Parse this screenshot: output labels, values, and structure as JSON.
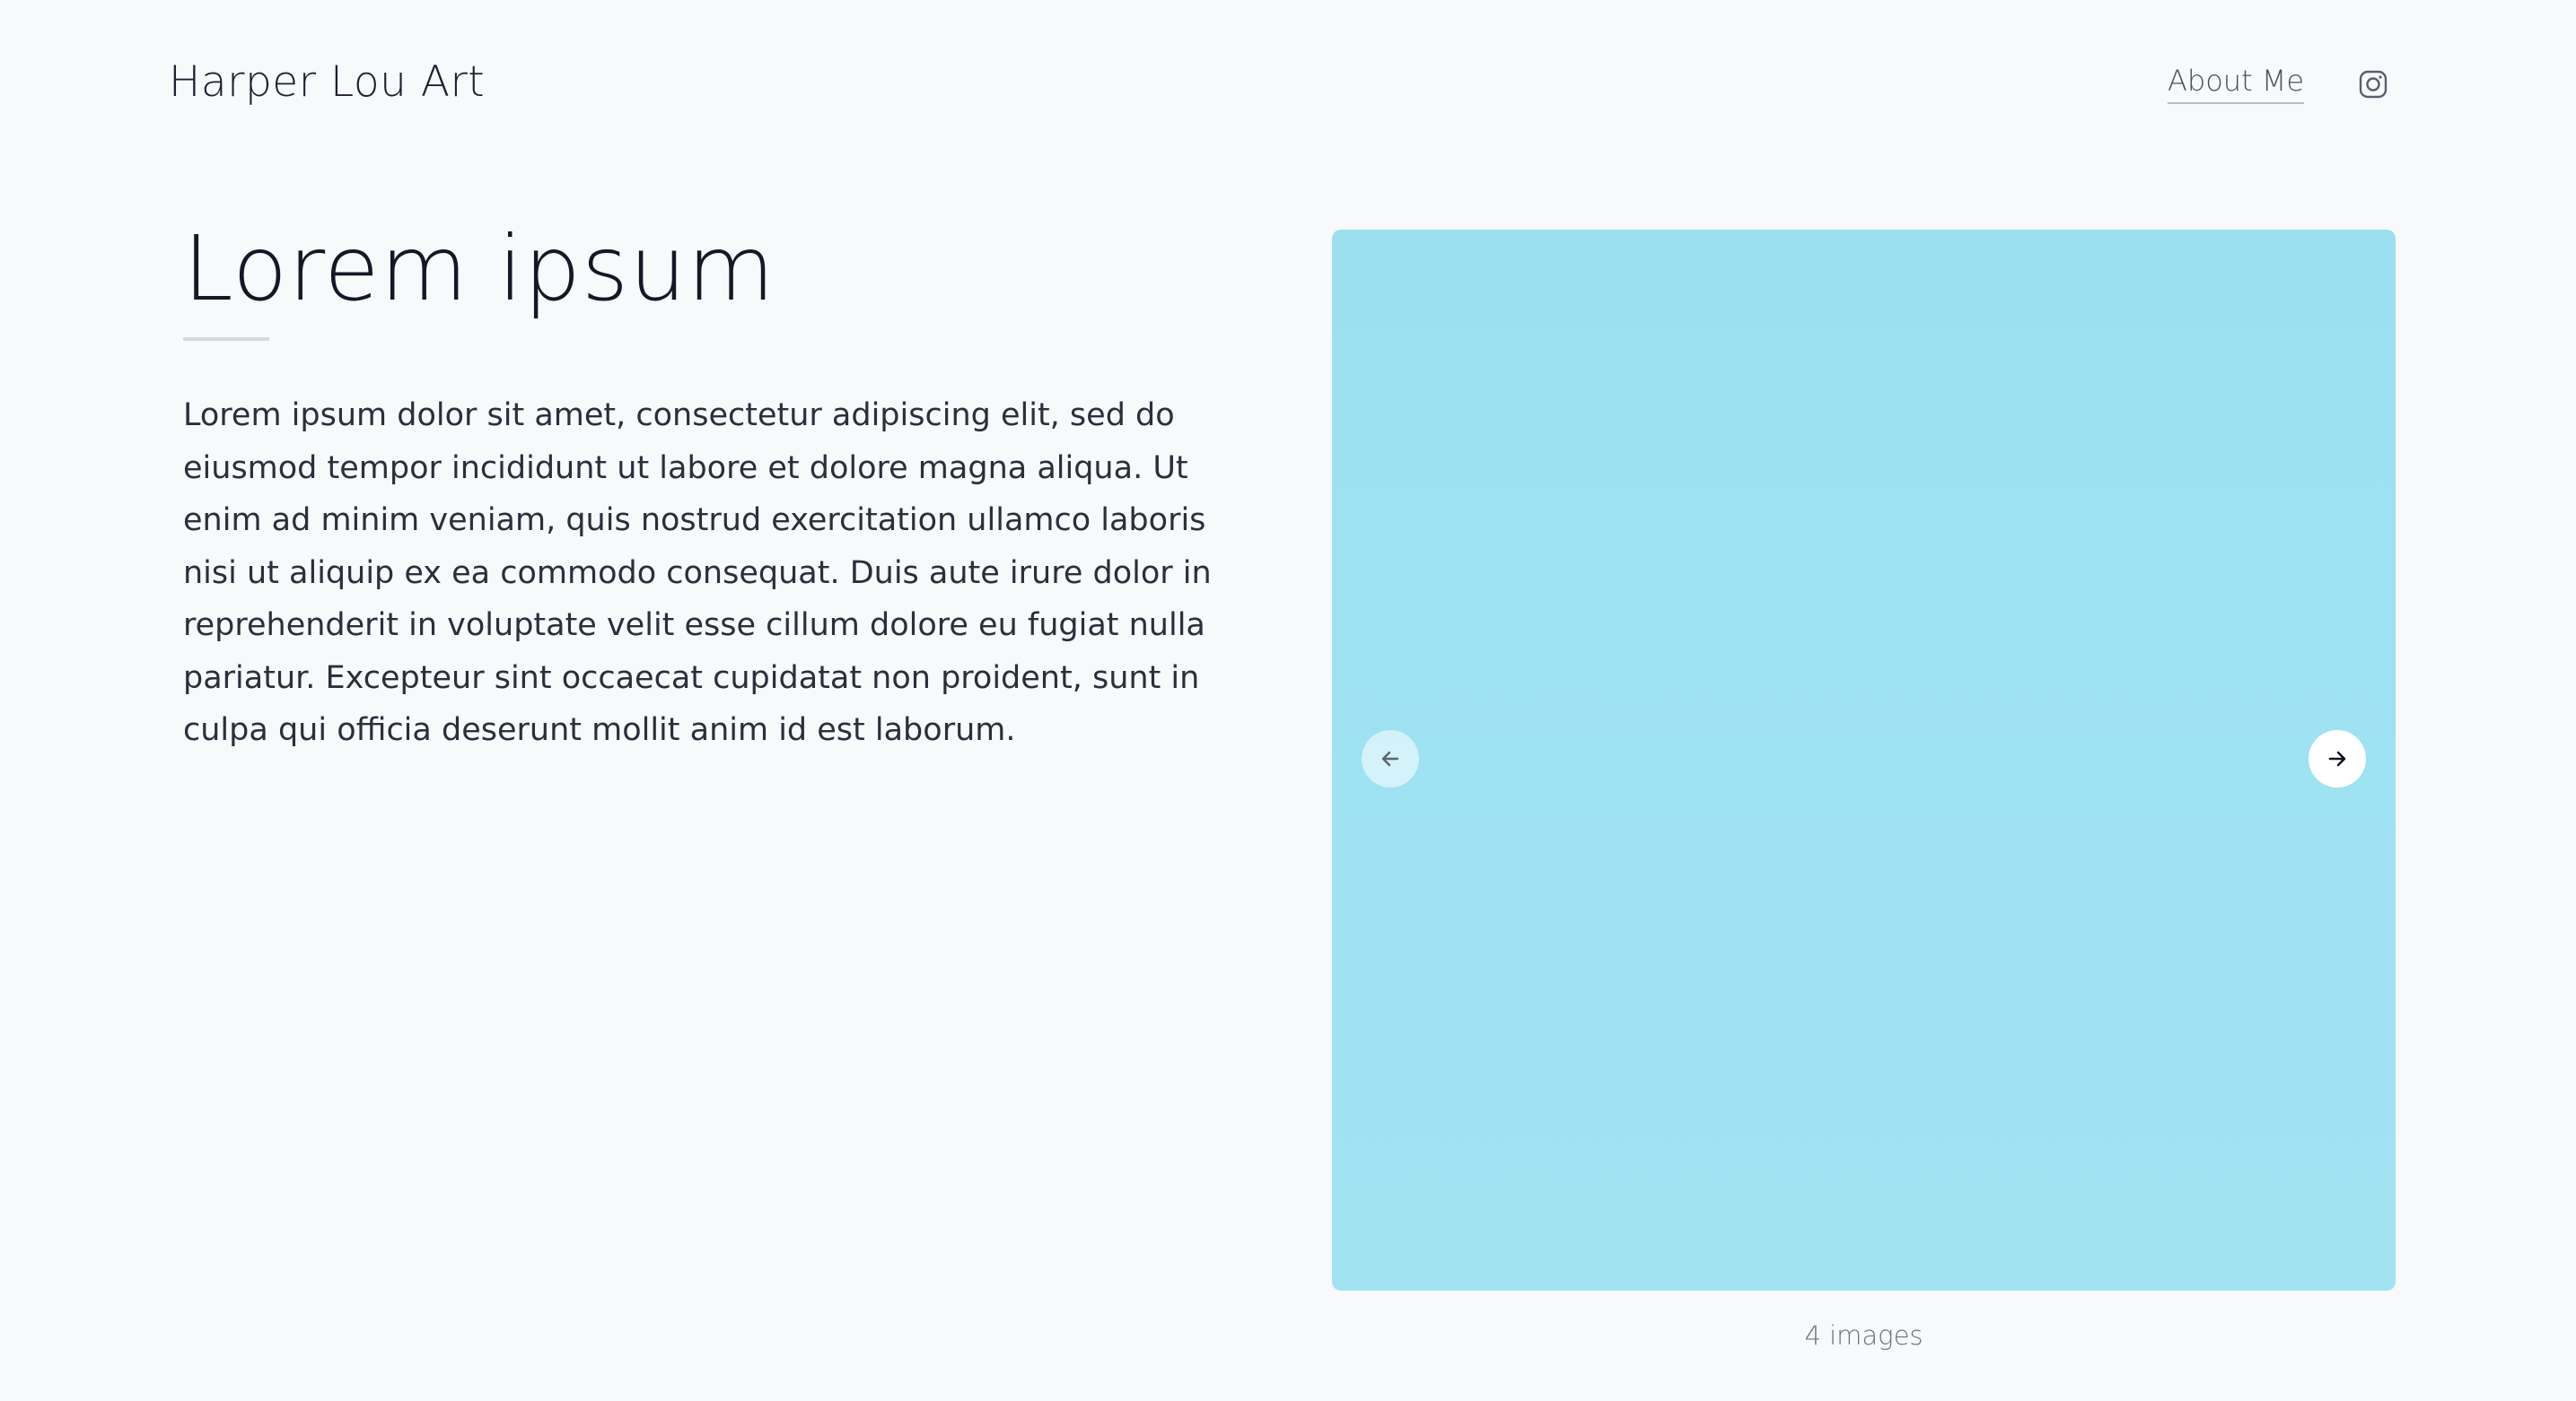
{
  "header": {
    "site_title": "Harper Lou Art",
    "nav": {
      "about_label": "About Me"
    },
    "social": {
      "icon": "instagram-icon"
    }
  },
  "main": {
    "title": "Lorem ipsum",
    "body": "Lorem ipsum dolor sit amet, consectetur adipiscing elit, sed do eiusmod tempor incididunt ut labore et dolore magna aliqua. Ut enim ad minim veniam, quis nostrud exercitation ullamco laboris nisi ut aliquip ex ea commodo consequat. Duis aute irure dolor in reprehenderit in voluptate velit esse cillum dolore eu fugiat nulla pariatur. Excepteur sint occaecat cupidatat non proident, sunt in culpa qui officia deserunt mollit anim id est laborum."
  },
  "gallery": {
    "image_color": "#9ee1f1",
    "prev_icon": "arrow-left-icon",
    "next_icon": "arrow-right-icon",
    "count_label": "4 images"
  },
  "colors": {
    "background": "#f8f9fb",
    "text": "#1c2030"
  }
}
